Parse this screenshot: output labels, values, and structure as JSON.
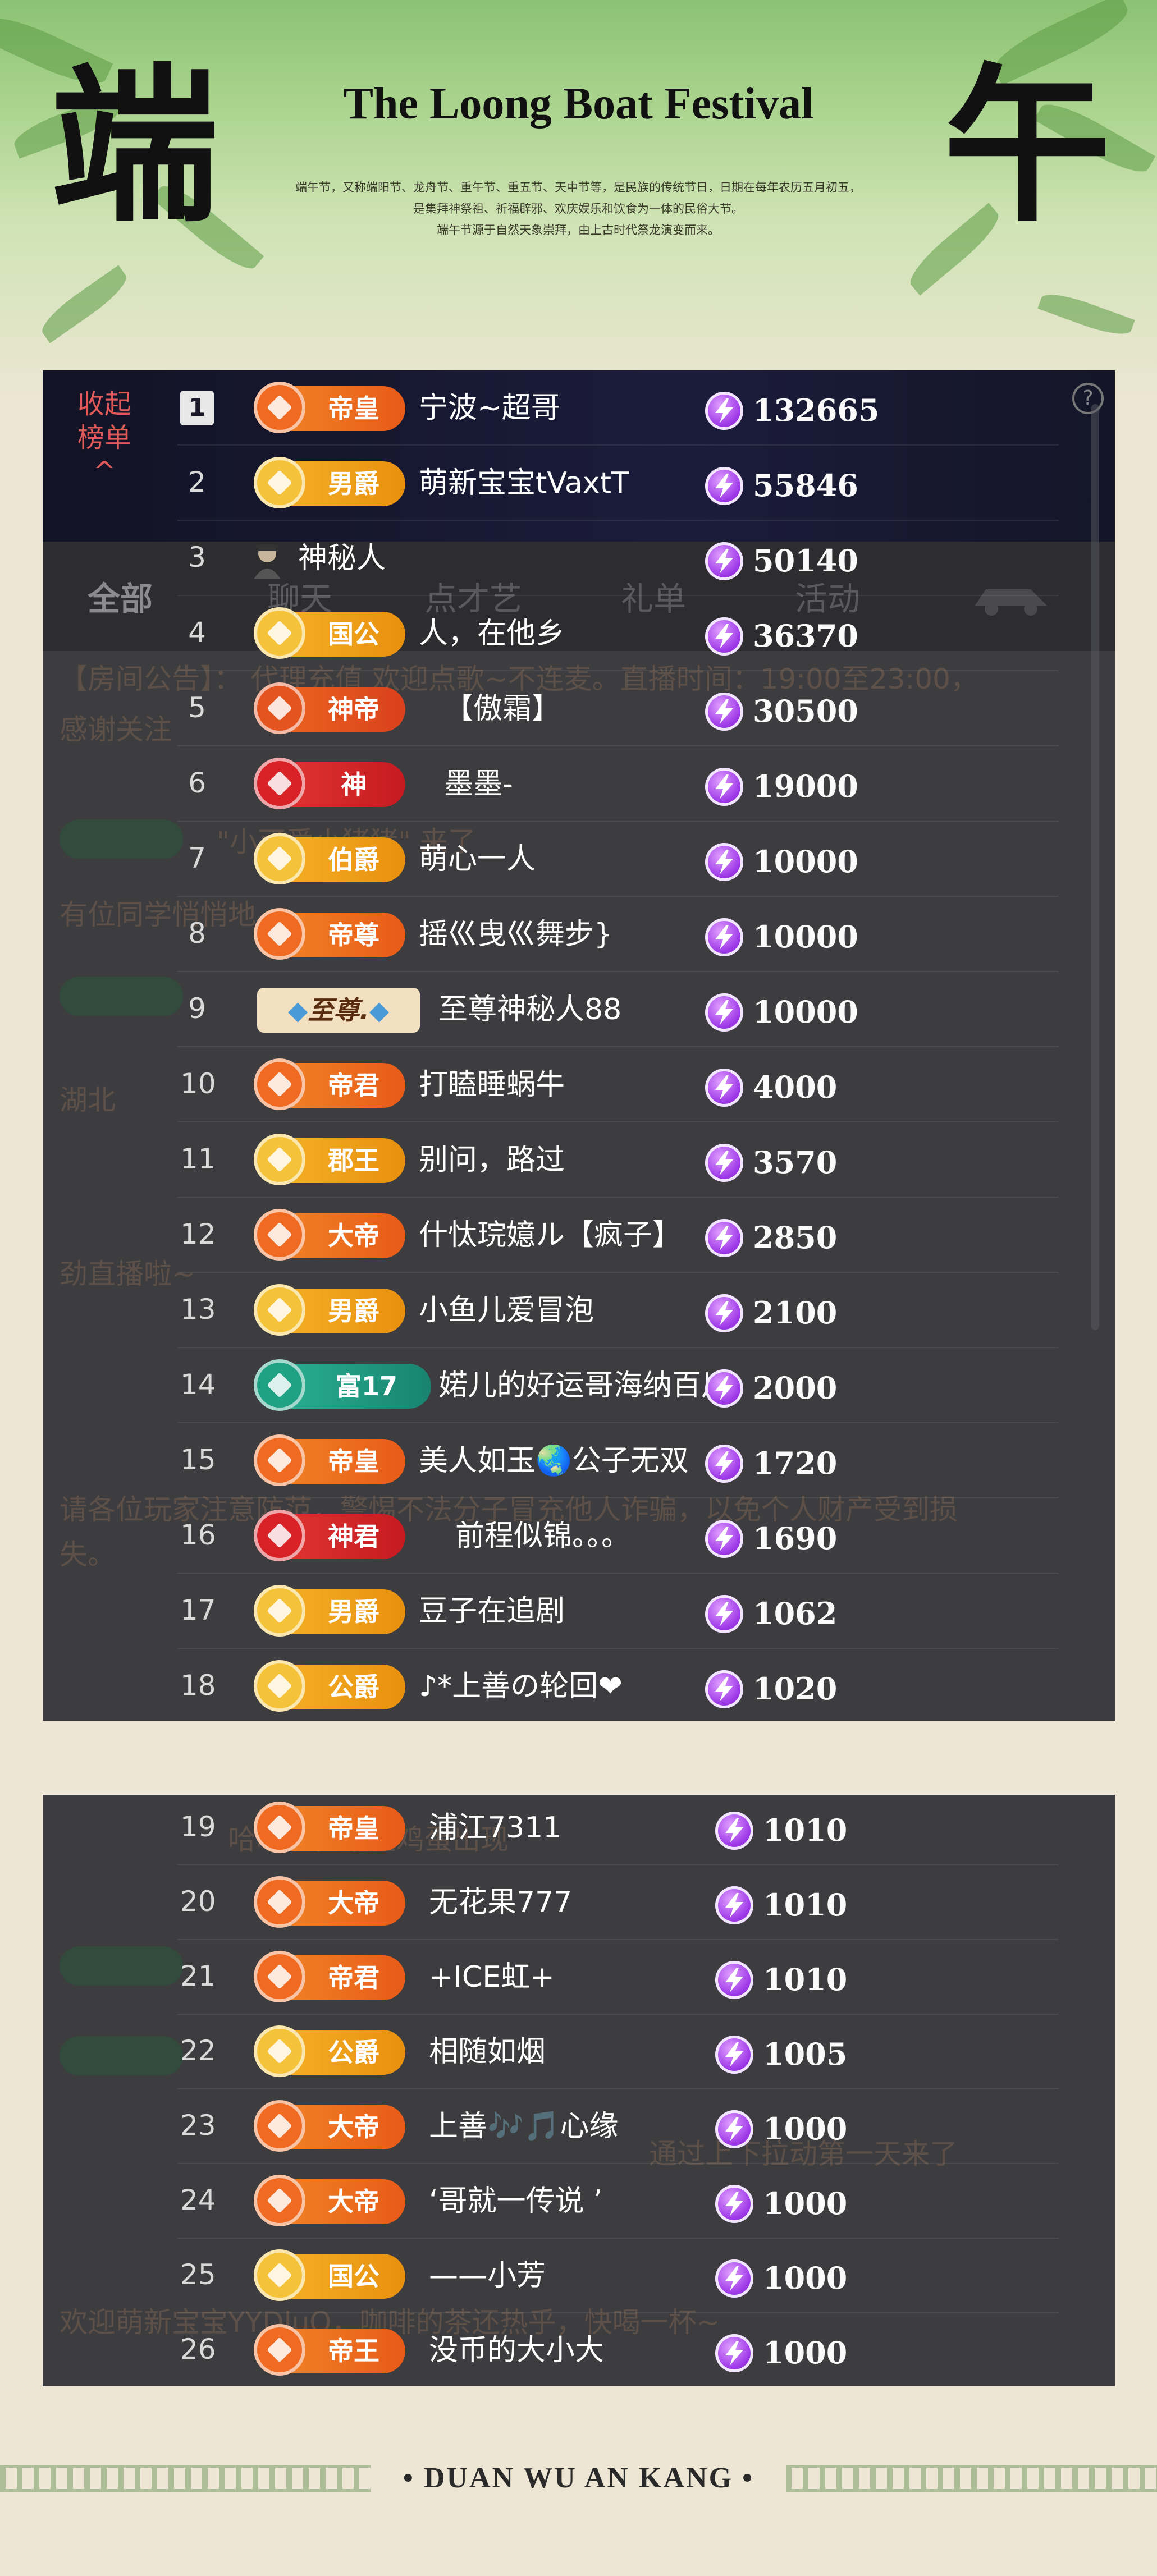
{
  "header": {
    "left_char": "端",
    "right_char": "午",
    "title": "The Loong Boat Festival",
    "desc_lines": [
      "端午节，又称端阳节、龙舟节、重午节、重五节、天中节等，是民族的传统节日，日期在每年农历五月初五，",
      "是集拜神祭祖、祈福辟邪、欢庆娱乐和饮食为一体的民俗大节。",
      "端午节源于自然天象崇拜，由上古时代祭龙演变而来。"
    ]
  },
  "panel": {
    "collapse_label_1": "收起",
    "collapse_label_2": "榜单",
    "collapse_arrow": "^",
    "help": "?"
  },
  "background_tabs": [
    "全部",
    "聊天",
    "点才艺",
    "礼单",
    "活动"
  ],
  "background_text": {
    "announce_1": "【房间公告】：  代理充值  欢迎点歌~不连麦。直播时间：19:00至23:00，",
    "announce_2": "感谢关注",
    "welcome": "\"小可爱小猪猪\" 来了",
    "peek": "有位同学悄悄地",
    "hubei": "湖北",
    "notice": "请各位玩家注意防范，警惕不法分子冒充他人诈骗，以免个人财产受到损",
    "notice_2": "失。",
    "live": "劲直播啦~",
    "chat_1": "哈哈现在不是鸡蛋出现",
    "chat_2": "通过上下拉动第一天来了",
    "chat_3": "欢迎萌新宝宝YYDluO，咖啡的茶还热乎，快喝一杯~"
  },
  "ranking": [
    {
      "rank": "1",
      "badge": "帝皇",
      "style": "dihuang",
      "name": "宁波~超哥",
      "score": "132665"
    },
    {
      "rank": "2",
      "badge": "男爵",
      "style": "gold",
      "name": "萌新宝宝tVaxtT",
      "score": "55846"
    },
    {
      "rank": "3",
      "badge": "",
      "style": "anon",
      "name": "神秘人",
      "score": "50140"
    },
    {
      "rank": "4",
      "badge": "国公",
      "style": "gold",
      "name": "人，在他乡",
      "score": "36370"
    },
    {
      "rank": "5",
      "badge": "神帝",
      "style": "shendi",
      "name": "【傲霜】",
      "score": "30500"
    },
    {
      "rank": "6",
      "badge": "神",
      "style": "red",
      "name": "墨墨-",
      "score": "19000"
    },
    {
      "rank": "7",
      "badge": "伯爵",
      "style": "gold",
      "name": "萌心一人",
      "score": "10000"
    },
    {
      "rank": "8",
      "badge": "帝尊",
      "style": "dihuang",
      "name": "摇巛曳巛舞步}",
      "score": "10000"
    },
    {
      "rank": "9",
      "badge": "至尊.",
      "style": "zhizun",
      "name": "至尊神秘人88",
      "score": "10000"
    },
    {
      "rank": "10",
      "badge": "帝君",
      "style": "dihuang",
      "name": "打瞌睡蜗牛",
      "score": "4000"
    },
    {
      "rank": "11",
      "badge": "郡王",
      "style": "gold",
      "name": "别问，路过",
      "score": "3570"
    },
    {
      "rank": "12",
      "badge": "大帝",
      "style": "dihuang",
      "name": "什忲琓嬑ル【疯子】",
      "score": "2850"
    },
    {
      "rank": "13",
      "badge": "男爵",
      "style": "gold",
      "name": "小鱼儿爱冒泡",
      "score": "2100"
    },
    {
      "rank": "14",
      "badge": "富17",
      "style": "teal",
      "name": "婼儿的好运哥海纳百川",
      "score": "2000"
    },
    {
      "rank": "15",
      "badge": "帝皇",
      "style": "dihuang",
      "name": "美人如玉🌏公子无双",
      "score": "1720"
    },
    {
      "rank": "16",
      "badge": "神君",
      "style": "red",
      "name": "前程似锦。。。",
      "score": "1690"
    },
    {
      "rank": "17",
      "badge": "男爵",
      "style": "gold",
      "name": "豆子在追剧",
      "score": "1062"
    },
    {
      "rank": "18",
      "badge": "公爵",
      "style": "gold",
      "name": "♪*上善の轮回❤",
      "score": "1020"
    }
  ],
  "ranking2": [
    {
      "rank": "19",
      "badge": "帝皇",
      "style": "dihuang",
      "name": "浦江7311",
      "score": "1010"
    },
    {
      "rank": "20",
      "badge": "大帝",
      "style": "dihuang",
      "name": "无花果777",
      "score": "1010"
    },
    {
      "rank": "21",
      "badge": "帝君",
      "style": "dihuang",
      "name": "+ICE虹+",
      "score": "1010"
    },
    {
      "rank": "22",
      "badge": "公爵",
      "style": "gold",
      "name": "相随如烟",
      "score": "1005"
    },
    {
      "rank": "23",
      "badge": "大帝",
      "style": "dihuang",
      "name": "上善🎶🎵心缘",
      "score": "1000"
    },
    {
      "rank": "24",
      "badge": "大帝",
      "style": "dihuang",
      "name": "‘哥就一传说 ’",
      "score": "1000"
    },
    {
      "rank": "25",
      "badge": "国公",
      "style": "gold",
      "name": "——小芳",
      "score": "1000"
    },
    {
      "rank": "26",
      "badge": "帝王",
      "style": "dihuang",
      "name": "没币的大小大",
      "score": "1000"
    }
  ],
  "colors": {
    "panel": "#3d3d3f",
    "gold_badge": "#f0a81a",
    "orange_badge": "#ee6a1e",
    "red_badge": "#d9242a",
    "teal_badge": "#1f9a82",
    "lightning": "#9e38e8"
  },
  "footer": {
    "text": "•  DUAN WU AN KANG  •"
  }
}
